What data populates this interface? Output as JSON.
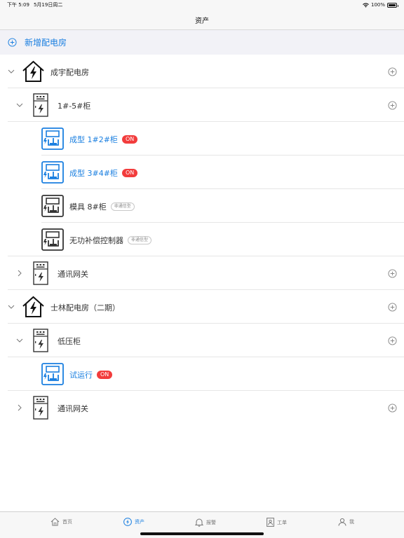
{
  "status": {
    "time": "下午 5:09",
    "date": "5月19日周二",
    "battery": "100%"
  },
  "nav": {
    "title": "资产"
  },
  "add_room": {
    "label": "新增配电房"
  },
  "tree": {
    "room1": {
      "name": "成宇配电房"
    },
    "group1": {
      "name": "1#-5#柜"
    },
    "dev1": {
      "name": "成型 1#2#柜",
      "badge": "ON"
    },
    "dev2": {
      "name": "成型 3#4#柜",
      "badge": "ON"
    },
    "dev3": {
      "name": "模具 8#柜",
      "badge": "非通信型"
    },
    "dev4": {
      "name": "无功补偿控制器",
      "badge": "非通信型"
    },
    "gateway1": {
      "name": "通讯网关"
    },
    "room2": {
      "name": "士林配电房（二期）"
    },
    "group2": {
      "name": "低压柜"
    },
    "dev5": {
      "name": "试运行",
      "badge": "ON"
    },
    "gateway2": {
      "name": "通讯网关"
    }
  },
  "tabs": [
    {
      "label": "首页",
      "icon": "home-icon"
    },
    {
      "label": "资产",
      "icon": "lightning-icon"
    },
    {
      "label": "报警",
      "icon": "bell-icon"
    },
    {
      "label": "工单",
      "icon": "workorder-icon"
    },
    {
      "label": "我",
      "icon": "user-icon"
    }
  ],
  "colors": {
    "accent": "#1a7fe0",
    "on_badge": "#f23c3c"
  }
}
